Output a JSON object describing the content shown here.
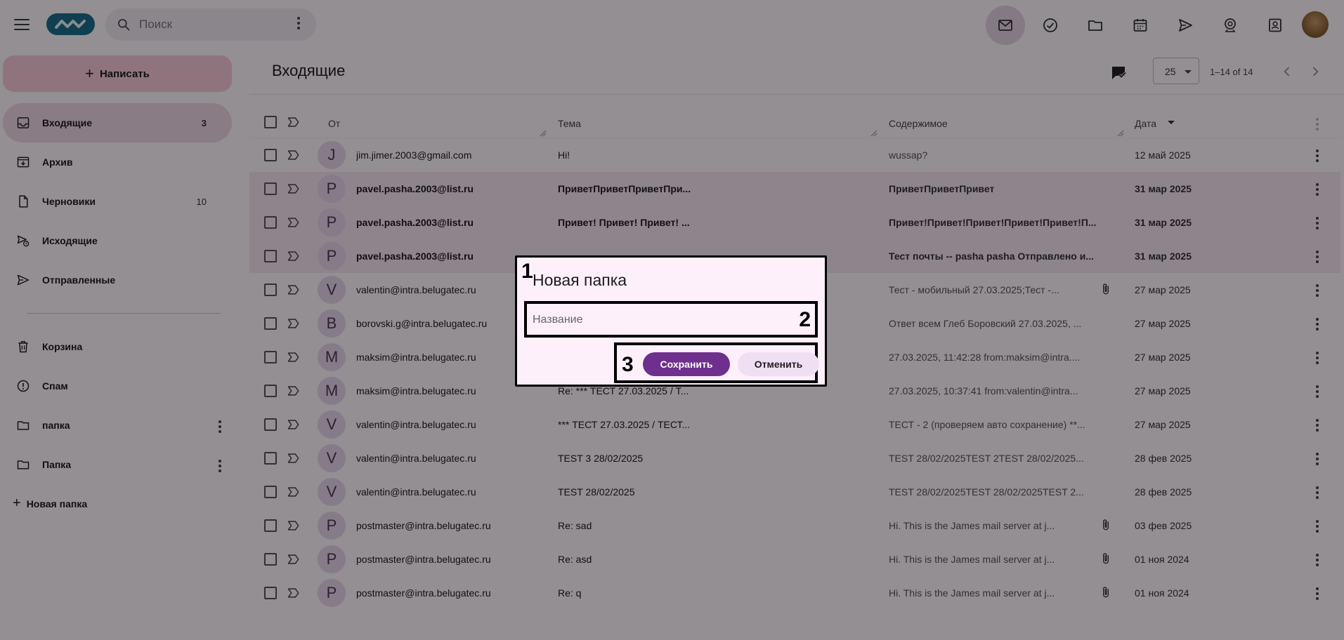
{
  "search": {
    "placeholder": "Поиск"
  },
  "sidebar": {
    "compose_label": "Написать",
    "items": [
      {
        "label": "Входящие",
        "count": "3"
      },
      {
        "label": "Архив",
        "count": ""
      },
      {
        "label": "Черновики",
        "count": "10"
      },
      {
        "label": "Исходящие",
        "count": ""
      },
      {
        "label": "Отправленные",
        "count": ""
      },
      {
        "label": "Корзина",
        "count": ""
      },
      {
        "label": "Спам",
        "count": ""
      },
      {
        "label": "папка",
        "count": ""
      },
      {
        "label": "Папка",
        "count": ""
      }
    ],
    "new_folder_label": "Новая папка"
  },
  "main": {
    "title": "Входящие",
    "page_size": "25",
    "range": "1–14 of 14",
    "columns": {
      "from": "От",
      "subject": "Тема",
      "content": "Содержимое",
      "date": "Дата"
    },
    "rows": [
      {
        "initial": "J",
        "from": "jim.jimer.2003@gmail.com",
        "subject": "Hi!",
        "content": "wussap?",
        "date": "12 май 2025",
        "unread": false,
        "attachment": false
      },
      {
        "initial": "P",
        "from": "pavel.pasha.2003@list.ru",
        "subject": "ПриветПриветПриветПри...",
        "content": "ПриветПриветПривет",
        "date": "31 мар 2025",
        "unread": true,
        "attachment": false
      },
      {
        "initial": "P",
        "from": "pavel.pasha.2003@list.ru",
        "subject": "Привет! Привет! Привет! ...",
        "content": "Привет!Привет!Привет!Привет!Привет!П...",
        "date": "31 мар 2025",
        "unread": true,
        "attachment": false
      },
      {
        "initial": "P",
        "from": "pavel.pasha.2003@list.ru",
        "subject": "",
        "content": "Тест почты -- pasha pasha Отправлено и...",
        "date": "31 мар 2025",
        "unread": true,
        "attachment": false
      },
      {
        "initial": "V",
        "from": "valentin@intra.belugatec.ru",
        "subject": "",
        "content": "Тест - мобильный 27.03.2025;Тест -...",
        "date": "27 мар 2025",
        "unread": false,
        "attachment": true
      },
      {
        "initial": "B",
        "from": "borovski.g@intra.belugatec.ru",
        "subject": "",
        "content": "Ответ всем Глеб Боровский 27.03.2025, ...",
        "date": "27 мар 2025",
        "unread": false,
        "attachment": false
      },
      {
        "initial": "M",
        "from": "maksim@intra.belugatec.ru",
        "subject": "",
        "content": "27.03.2025, 11:42:28 from:maksim@intra....",
        "date": "27 мар 2025",
        "unread": false,
        "attachment": false
      },
      {
        "initial": "M",
        "from": "maksim@intra.belugatec.ru",
        "subject": "Re: *** ТЕСТ 27.03.2025 / Т...",
        "content": "27.03.2025, 10:37:41 from:valentin@intra...",
        "date": "27 мар 2025",
        "unread": false,
        "attachment": false
      },
      {
        "initial": "V",
        "from": "valentin@intra.belugatec.ru",
        "subject": "*** ТЕСТ 27.03.2025 / ТЕСТ...",
        "content": "ТЕСТ - 2 (проверяем авто сохранение) **...",
        "date": "27 мар 2025",
        "unread": false,
        "attachment": false
      },
      {
        "initial": "V",
        "from": "valentin@intra.belugatec.ru",
        "subject": "TEST 3 28/02/2025",
        "content": "TEST 28/02/2025TEST 2TEST 28/02/2025...",
        "date": "28 фев 2025",
        "unread": false,
        "attachment": false
      },
      {
        "initial": "V",
        "from": "valentin@intra.belugatec.ru",
        "subject": "TEST 28/02/2025",
        "content": "TEST 28/02/2025TEST 28/02/2025TEST 2...",
        "date": "28 фев 2025",
        "unread": false,
        "attachment": false
      },
      {
        "initial": "P",
        "from": "postmaster@intra.belugatec.ru",
        "subject": "Re: sad",
        "content": "Hi. This is the James mail server at j...",
        "date": "03 фев 2025",
        "unread": false,
        "attachment": true
      },
      {
        "initial": "P",
        "from": "postmaster@intra.belugatec.ru",
        "subject": "Re: asd",
        "content": "Hi. This is the James mail server at j...",
        "date": "01 ноя 2024",
        "unread": false,
        "attachment": true
      },
      {
        "initial": "P",
        "from": "postmaster@intra.belugatec.ru",
        "subject": "Re: q",
        "content": "Hi. This is the James mail server at j...",
        "date": "01 ноя 2024",
        "unread": false,
        "attachment": true
      }
    ]
  },
  "dialog": {
    "marker1": "1",
    "title": "Новая папка",
    "name_placeholder": "Название",
    "name_value": "",
    "marker2": "2",
    "marker3": "3",
    "save_label": "Сохранить",
    "cancel_label": "Отменить"
  },
  "colors": {
    "accent": "#6f2f8d",
    "compose": "#f7c9d9",
    "selected": "#ecd6e6"
  }
}
